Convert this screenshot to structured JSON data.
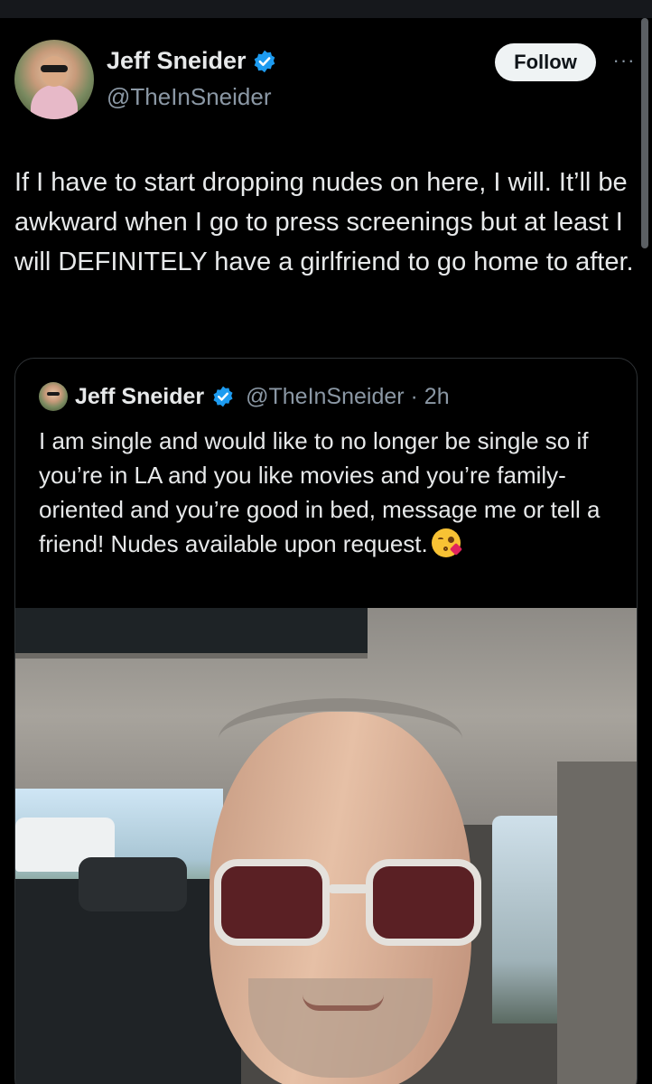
{
  "author": {
    "name": "Jeff Sneider",
    "handle": "@TheInSneider",
    "verified": true,
    "avatar_icon": "profile-photo"
  },
  "actions": {
    "follow_label": "Follow",
    "more_icon": "more-icon",
    "more_glyph": "···"
  },
  "tweet": {
    "text": "If I have to start dropping nudes on here, I will. It’ll be awkward when I go to press screenings but at least I will DEFINITELY have a girlfriend to go home to after."
  },
  "quoted": {
    "name": "Jeff Sneider",
    "handle_time": "@TheInSneider · 2h",
    "text": "I am single and would like to no longer be single so if you’re in LA and you like movies and you’re family-oriented and you’re good in bed, message me or tell a friend! Nudes available upon request.",
    "emoji": "face-blowing-a-kiss",
    "photo": "selfie-in-car"
  },
  "colors": {
    "background": "#000000",
    "text_primary": "#e7e9ea",
    "text_secondary": "#8b98a5",
    "verified_blue": "#1d9bf0",
    "follow_button_bg": "#eff3f4",
    "border": "#2f3336"
  }
}
